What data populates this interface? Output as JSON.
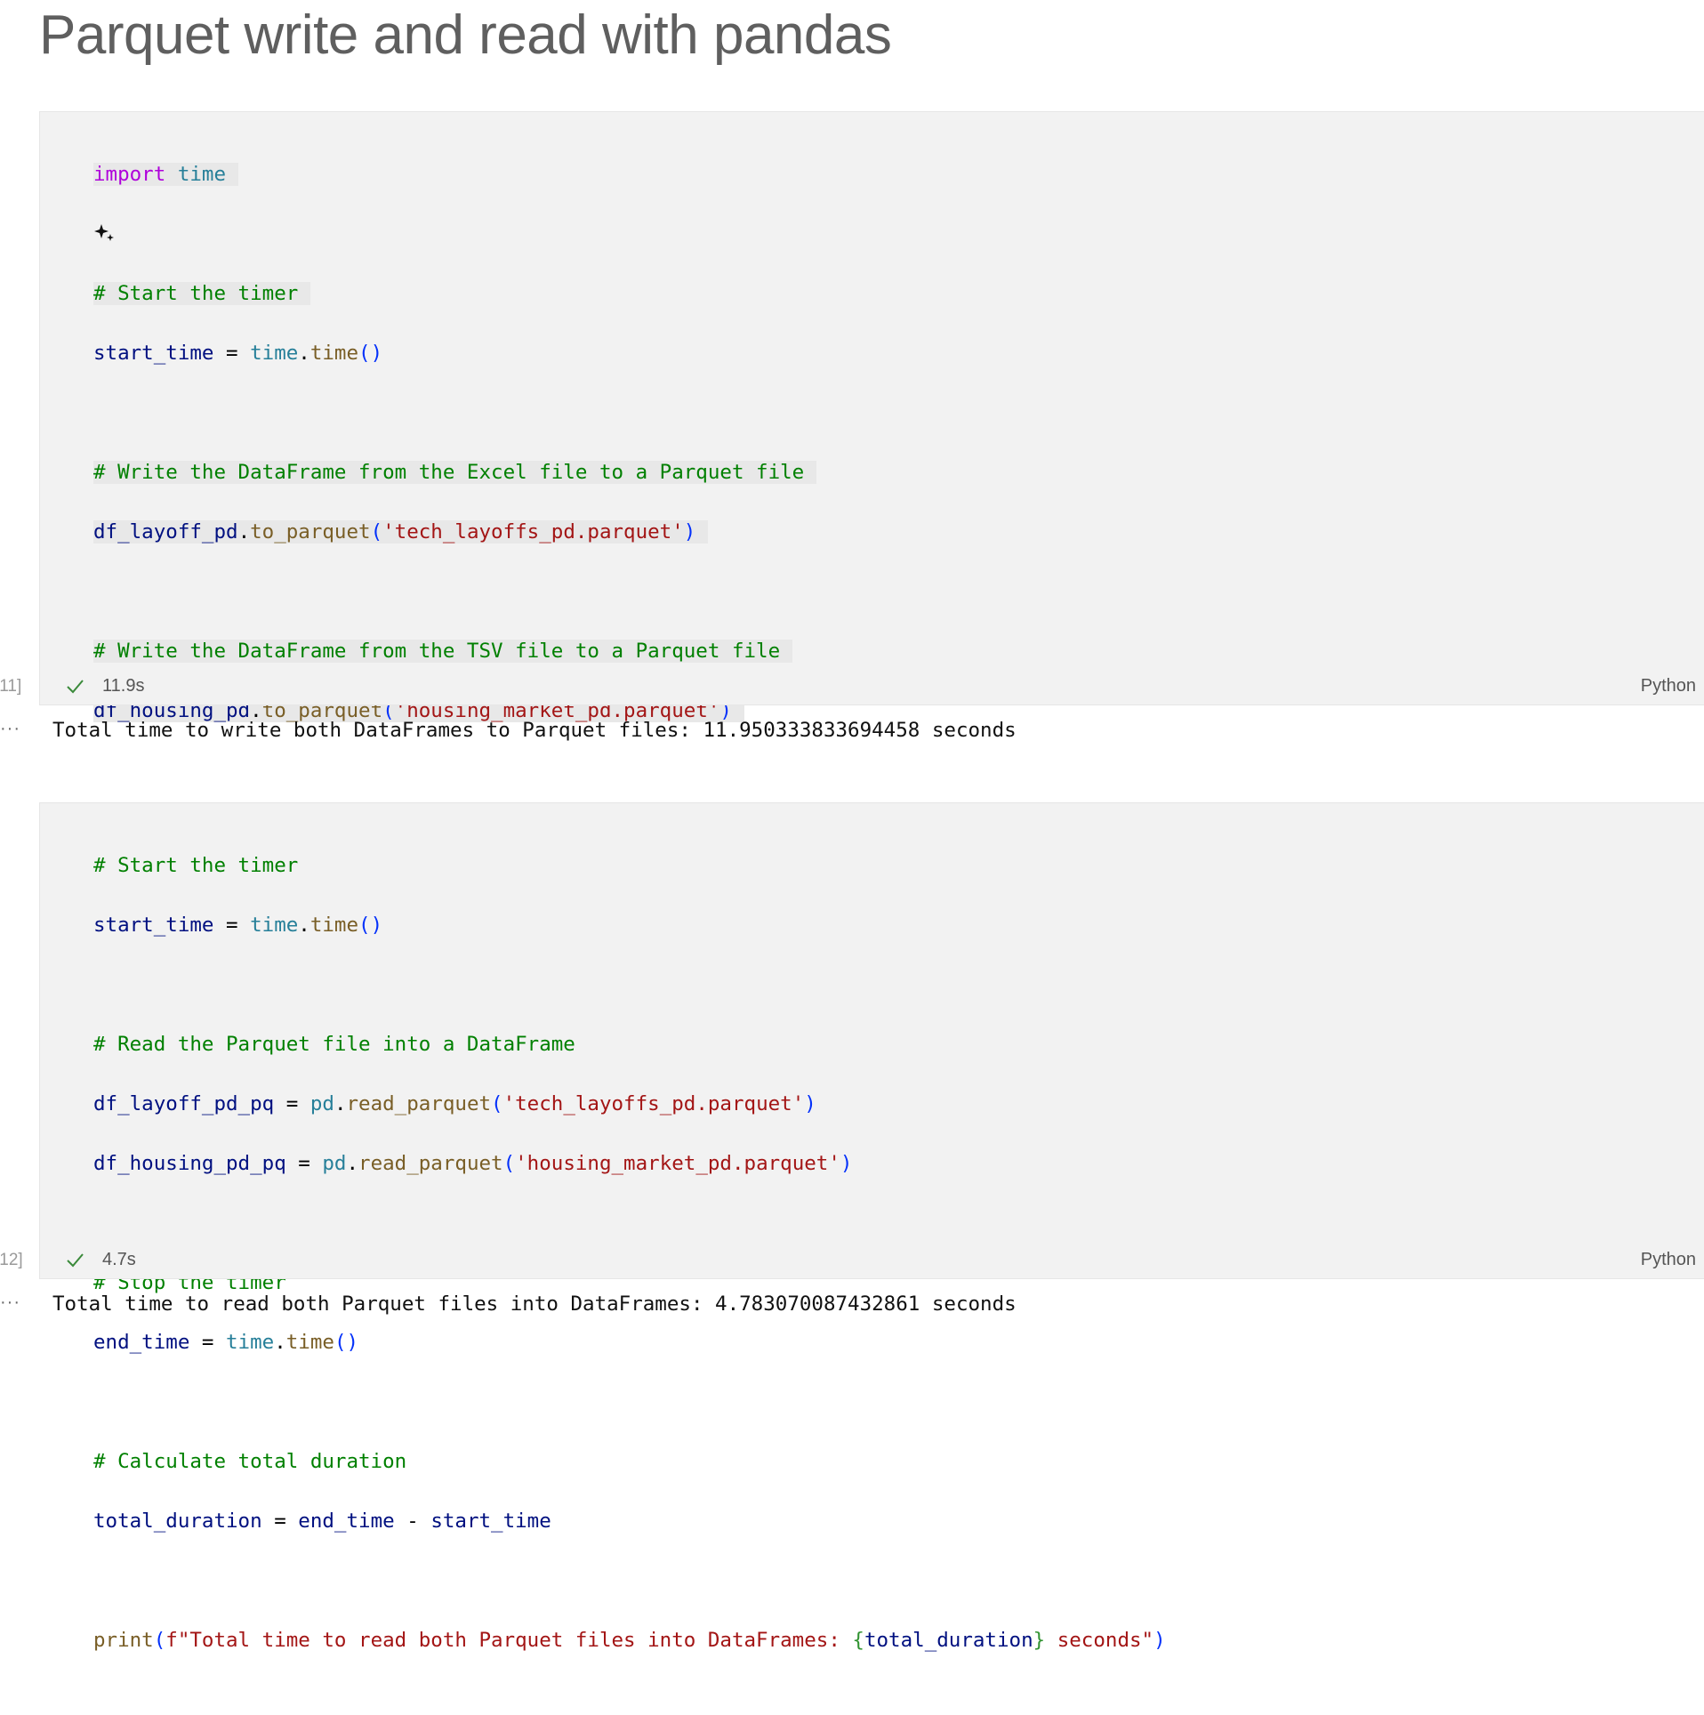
{
  "title": "Parquet write and read with pandas",
  "cells": [
    {
      "execution_count": "[11]",
      "duration": "11.9s",
      "language": "Python",
      "output_prompt": "···",
      "output": "Total time to write both DataFrames to Parquet files: 11.950333833694458 seconds"
    },
    {
      "execution_count": "[12]",
      "duration": "4.7s",
      "language": "Python",
      "output_prompt": "···",
      "output": "Total time to read both Parquet files into DataFrames: 4.783070087432861 seconds"
    }
  ],
  "icons": {
    "status": "check-icon",
    "sparkle": "sparkle-icon"
  },
  "colors": {
    "keyword": "#af00db",
    "module": "#267f99",
    "function": "#795e26",
    "string": "#a31515",
    "comment": "#008000",
    "variable": "#001080",
    "paren": "#0431fa",
    "brace": "#319331",
    "check": "#3a8a3a"
  }
}
